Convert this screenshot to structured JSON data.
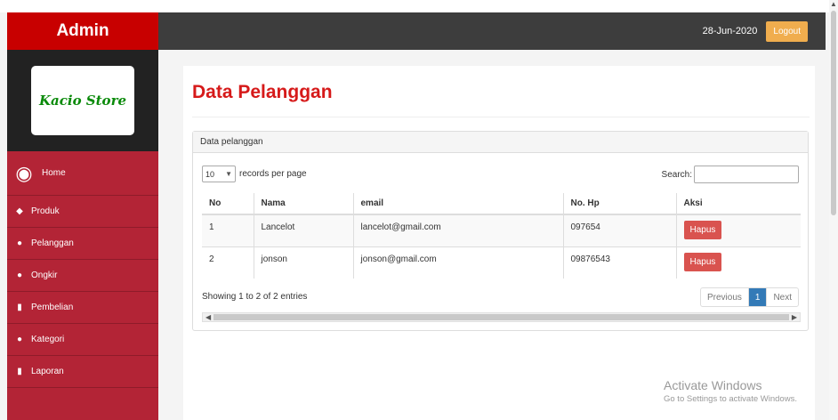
{
  "header": {
    "brand": "Admin",
    "date": "28-Jun-2020",
    "logout_label": "Logout"
  },
  "sidebar": {
    "logo_text": "Kacio Store",
    "items": [
      {
        "label": "Home",
        "icon": "dashboard-icon"
      },
      {
        "label": "Produk",
        "icon": "cube-icon"
      },
      {
        "label": "Pelanggan",
        "icon": "users-icon"
      },
      {
        "label": "Ongkir",
        "icon": "truck-icon"
      },
      {
        "label": "Pembelian",
        "icon": "file-icon"
      },
      {
        "label": "Kategori",
        "icon": "tags-icon"
      },
      {
        "label": "Laporan",
        "icon": "file-icon"
      }
    ]
  },
  "main": {
    "page_title": "Data Pelanggan",
    "card_title": "Data pelanggan",
    "length_value": "10",
    "length_label": "records per page",
    "search_label": "Search:",
    "columns": [
      "No",
      "Nama",
      "email",
      "No. Hp",
      "Aksi"
    ],
    "rows": [
      {
        "no": "1",
        "nama": "Lancelot",
        "email": "lancelot@gmail.com",
        "hp": "097654",
        "action": "Hapus"
      },
      {
        "no": "2",
        "nama": "jonson",
        "email": "jonson@gmail.com",
        "hp": "09876543",
        "action": "Hapus"
      }
    ],
    "info": "Showing 1 to 2 of 2 entries",
    "pager": {
      "prev": "Previous",
      "current": "1",
      "next": "Next"
    }
  },
  "watermark": {
    "line1": "Activate Windows",
    "line2": "Go to Settings to activate Windows."
  },
  "colors": {
    "brand_red": "#c80000",
    "sidebar_red": "#b32436",
    "title_red": "#d61a1a",
    "danger": "#d9534f",
    "logout": "#f0ad4e",
    "primary": "#337ab7"
  }
}
